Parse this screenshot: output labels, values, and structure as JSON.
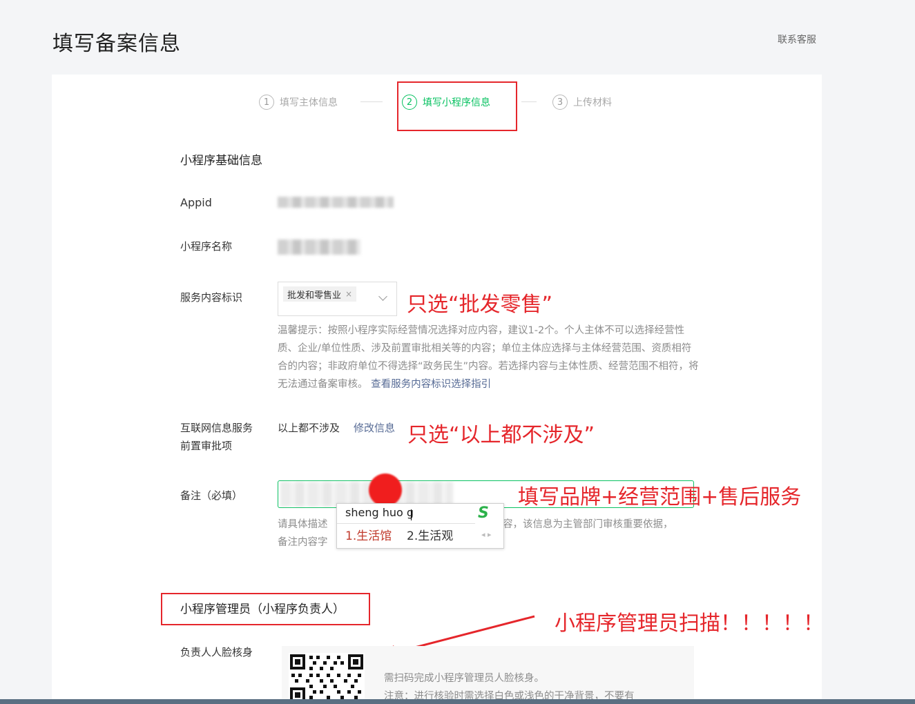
{
  "page": {
    "title": "填写备案信息",
    "contact": "联系客服"
  },
  "steps": [
    {
      "num": "1",
      "label": "填写主体信息"
    },
    {
      "num": "2",
      "label": "填写小程序信息"
    },
    {
      "num": "3",
      "label": "上传材料"
    }
  ],
  "section_basic": "小程序基础信息",
  "fields": {
    "appid_label": "Appid",
    "name_label": "小程序名称",
    "service_label": "服务内容标识",
    "service_tag": "批发和零售业",
    "service_tag_remove": "×",
    "hint_text": "温馨提示：按照小程序实际经营情况选择对应内容，建议1-2个。个人主体不可以选择经营性质、企业/单位性质、涉及前置审批相关等的内容；单位主体应选择与主体经营范围、资质相符合的内容；非政府单位不得选择“政务民生”内容。若选择内容与主体性质、经营范围不相符，将无法通过备案审核。",
    "hint_link": "查看服务内容标识选择指引",
    "internet_label_1": "互联网信息服务",
    "internet_label_2": "前置审批项",
    "internet_value": "以上都不涉及",
    "internet_edit": "修改信息",
    "remark_label": "备注（必填）",
    "remark_hint_1_start": "请具体描述",
    "remark_hint_1_end": "容，该信息为主管部门审核重要依据，",
    "remark_hint_2": "备注内容字"
  },
  "ime": {
    "pinyin": "sheng huo g",
    "candidates": [
      "1.生活馆",
      "2.生活观"
    ],
    "logo": "S"
  },
  "section_admin": "小程序管理员（小程序负责人）",
  "face_label": "负责人人脸核身",
  "qr_hint_1": "需扫码完成小程序管理员人脸核身。",
  "qr_hint_2": "注意：进行核验时需选择白色或浅色的干净背景，不要有",
  "annotations": {
    "service": "只选“批发零售”",
    "internet": "只选“以上都不涉及”",
    "remark": "填写品牌+经营范围+售后服务",
    "admin": "小程序管理员扫描！！！！！"
  },
  "colors": {
    "accent": "#07c160",
    "annotation": "#e5262b"
  }
}
